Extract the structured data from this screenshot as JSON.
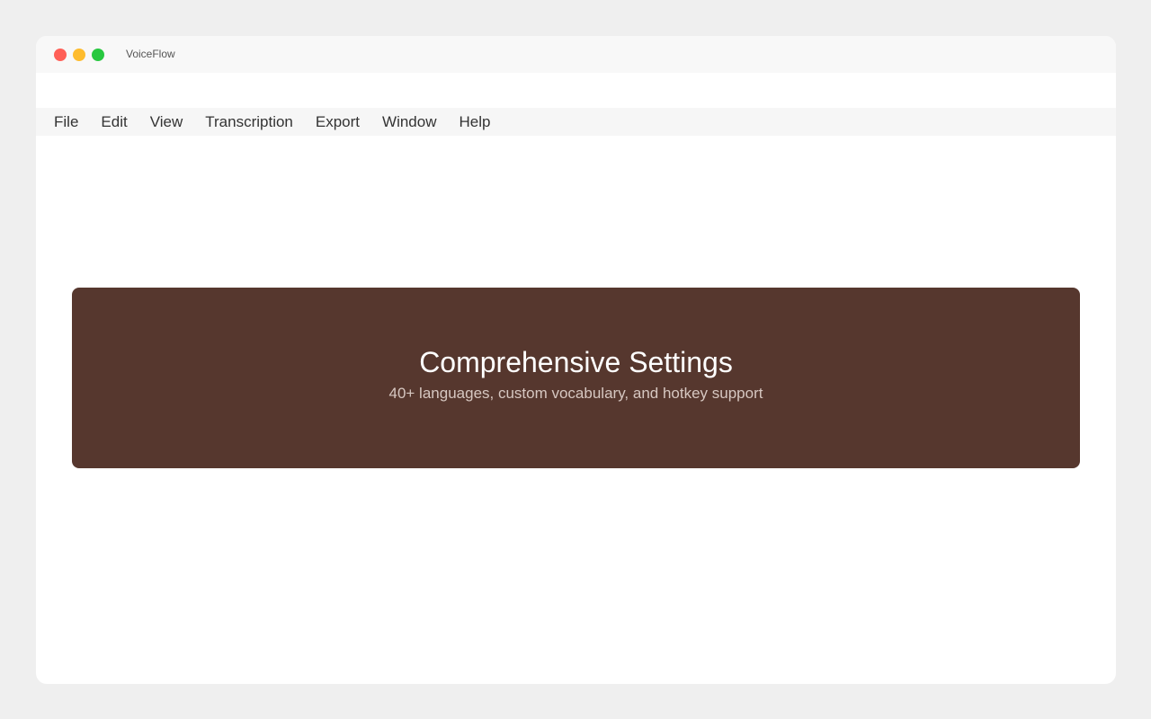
{
  "window": {
    "title": "VoiceFlow"
  },
  "menu": {
    "items": [
      {
        "label": "File"
      },
      {
        "label": "Edit"
      },
      {
        "label": "View"
      },
      {
        "label": "Transcription"
      },
      {
        "label": "Export"
      },
      {
        "label": "Window"
      },
      {
        "label": "Help"
      }
    ]
  },
  "banner": {
    "title": "Comprehensive Settings",
    "subtitle": "40+ languages, custom vocabulary, and hotkey support"
  },
  "colors": {
    "close": "#ff5f57",
    "minimize": "#febc2e",
    "maximize": "#28c840",
    "banner_bg": "#56372e"
  }
}
